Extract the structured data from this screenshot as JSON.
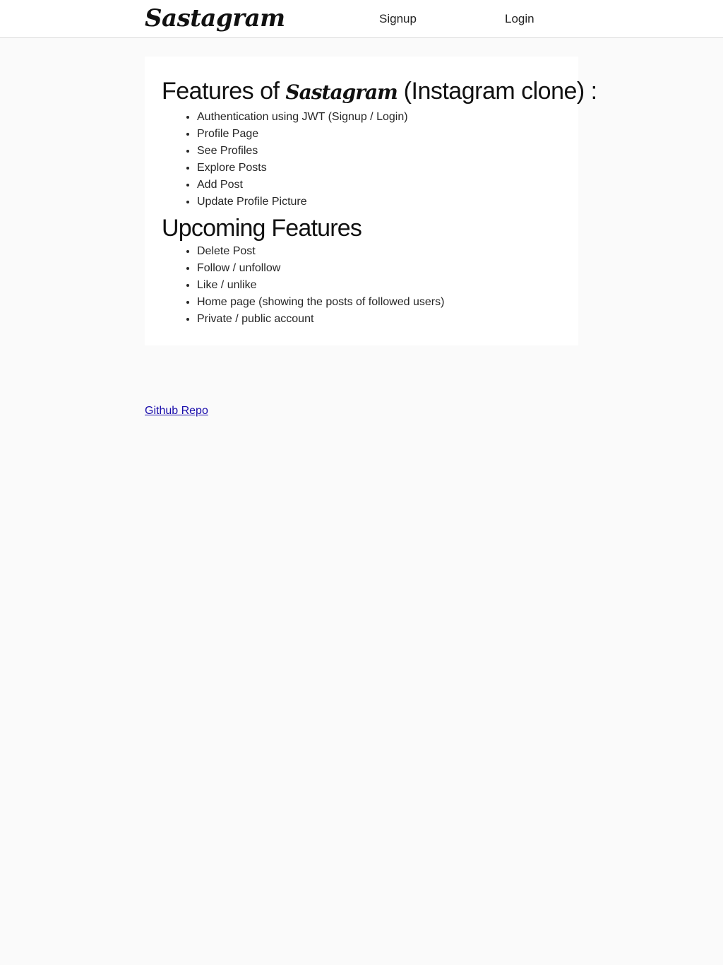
{
  "header": {
    "brand": "Sastagram",
    "nav": {
      "signup": "Signup",
      "login": "Login"
    }
  },
  "main": {
    "features_title": {
      "prefix": "Features of ",
      "brand": "Sastagram",
      "suffix": " (Instagram clone) :"
    },
    "features": [
      "Authentication using JWT (Signup / Login)",
      "Profile Page",
      "See Profiles",
      "Explore Posts",
      "Add Post",
      "Update Profile Picture"
    ],
    "upcoming_title": "Upcoming Features",
    "upcoming": [
      "Delete Post",
      "Follow / unfollow",
      "Like / unlike",
      "Home page (showing the posts of followed users)",
      "Private / public account"
    ]
  },
  "footer": {
    "github_link": "Github Repo"
  },
  "colors": {
    "page_background": "#fafafa",
    "card_background": "#ffffff",
    "link": "#1a0dab",
    "border": "#dbdbdb"
  }
}
